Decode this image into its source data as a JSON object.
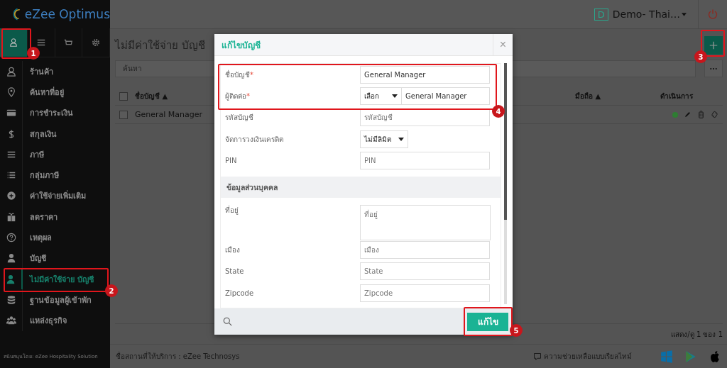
{
  "brand": {
    "name": "eZee Optimus"
  },
  "sidebar": {
    "tabs": [
      {
        "selected": true
      },
      {
        "selected": false
      },
      {
        "selected": false
      },
      {
        "selected": false
      }
    ],
    "items": [
      {
        "label": "ร้านค้า",
        "selected": false
      },
      {
        "label": "ค้นหาที่อยู่",
        "selected": false
      },
      {
        "label": "การชำระเงิน",
        "selected": false
      },
      {
        "label": "สกุลเงิน",
        "selected": false
      },
      {
        "label": "ภาษี",
        "selected": false
      },
      {
        "label": "กลุ่มภาษี",
        "selected": false
      },
      {
        "label": "ค่าใช้จ่ายเพิ่มเติม",
        "selected": false
      },
      {
        "label": "ลดราคา",
        "selected": false
      },
      {
        "label": "เหตุผล",
        "selected": false
      },
      {
        "label": "บัญชี",
        "selected": false
      },
      {
        "label": "ไม่มีค่าใช้จ่าย บัญชี",
        "selected": true
      },
      {
        "label": "ฐานข้อมูลผู้เข้าพัก",
        "selected": false
      },
      {
        "label": "แหล่งธุรกิจ",
        "selected": false
      }
    ],
    "footer": "สนับสนุนโดย: eZee Hospitality Solution"
  },
  "header": {
    "property_initial": "D",
    "property_name": "Demo- Thai…"
  },
  "page": {
    "title": "ไม่มีค่าใช้จ่าย บัญชี",
    "search_placeholder": "ค้นหา",
    "table": {
      "columns": [
        {
          "label": "ชื่อบัญชี ▲"
        },
        {
          "label": "มือถือ ▲"
        },
        {
          "label": "ดำเนินการ"
        }
      ],
      "select_all_checked": false,
      "rows": [
        {
          "name": "General Manager",
          "checked": false,
          "color": "#2e7d32"
        }
      ]
    },
    "pagination": "แสดง/ดู 1 ของ 1"
  },
  "footer": {
    "provider": "ชื่อสถานที่ให้บริการ : eZee Technosys",
    "help": "ความช่วยเหลือแบบเรียลไทม์"
  },
  "modal": {
    "title": "แก้ไขบัญชี",
    "close": "×",
    "fields": [
      {
        "kind": "input",
        "label": "ชื่อบัญชี",
        "required_mark": "*",
        "value": "General Manager"
      },
      {
        "kind": "select-input",
        "label": "ผู้ติดต่อ",
        "required_mark": "*",
        "select": "เลือก",
        "value": "General Manager"
      },
      {
        "kind": "input",
        "label": "รหัสบัญชี",
        "placeholder": "รหัสบัญชี"
      },
      {
        "kind": "select",
        "label": "จัดการวงเงินเครดิต",
        "select": "ไม่มีลิมิต"
      },
      {
        "kind": "input",
        "label": "PIN",
        "placeholder": "PIN"
      }
    ],
    "section": {
      "title": "ข้อมูลส่วนบุคคล",
      "fields": [
        {
          "kind": "textarea",
          "label": "ที่อยู่",
          "placeholder": "ที่อยู่"
        },
        {
          "kind": "input",
          "label": "เมือง",
          "placeholder": "เมือง"
        },
        {
          "kind": "input",
          "label": "State",
          "placeholder": "State"
        },
        {
          "kind": "input",
          "label": "Zipcode",
          "placeholder": "Zipcode"
        }
      ]
    },
    "submit": "แก้ไข"
  },
  "annotations": [
    {
      "number": "1"
    },
    {
      "number": "2"
    },
    {
      "number": "3"
    },
    {
      "number": "4"
    },
    {
      "number": "5"
    }
  ]
}
